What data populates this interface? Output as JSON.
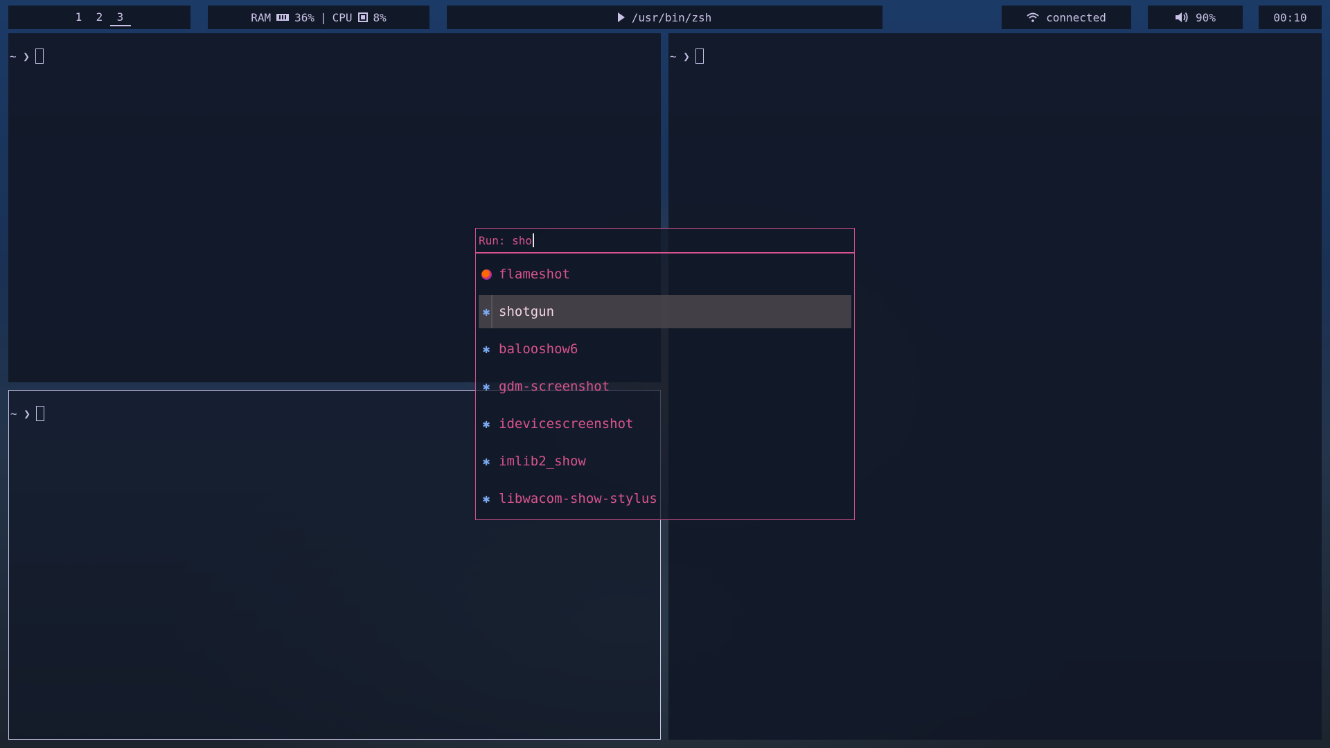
{
  "topbar": {
    "workspaces": [
      "1",
      "2",
      "3"
    ],
    "active_workspace": "3",
    "ram_label": "RAM",
    "ram_value": "36%",
    "separator": "|",
    "cpu_label": "CPU",
    "cpu_value": "8%",
    "command": "/usr/bin/zsh",
    "network_status": "connected",
    "volume": "90%",
    "clock": "00:10"
  },
  "terminals": {
    "prompt": "~ ❯"
  },
  "launcher": {
    "prompt": "Run: sho",
    "items": [
      {
        "label": "flameshot",
        "icon": "flameshot-icon"
      },
      {
        "label": "shotgun",
        "icon": "puzzle-icon",
        "selected": true
      },
      {
        "label": "balooshow6",
        "icon": "puzzle-icon"
      },
      {
        "label": "gdm-screenshot",
        "icon": "puzzle-icon"
      },
      {
        "label": "idevicescreenshot",
        "icon": "puzzle-icon"
      },
      {
        "label": "imlib2_show",
        "icon": "puzzle-icon"
      },
      {
        "label": "libwacom-show-stylus",
        "icon": "puzzle-icon"
      }
    ]
  },
  "colors": {
    "bar_bg": "#111827",
    "text": "#c9c2e6",
    "accent": "#d8548e",
    "icon_blue": "#7aa8f0"
  }
}
